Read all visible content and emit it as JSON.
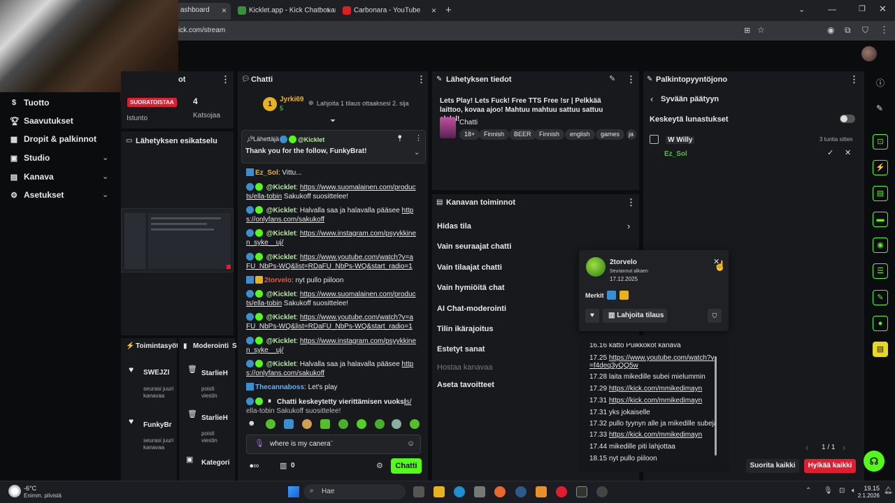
{
  "browser": {
    "tabs": [
      {
        "title": "ashboard"
      },
      {
        "title": "Kicklet.app - Kick Chatbot and"
      },
      {
        "title": "Carbonara - YouTube"
      }
    ],
    "url": "kick.com/stream",
    "new_tab": "+"
  },
  "sidebar": {
    "items": [
      {
        "label": "Tuotto",
        "icon": "money-icon"
      },
      {
        "label": "Saavutukset",
        "icon": "trophy-icon"
      },
      {
        "label": "Dropit & palkinnot",
        "icon": "gift-icon"
      },
      {
        "label": "Studio",
        "icon": "studio-icon"
      },
      {
        "label": "Kanava",
        "icon": "channel-icon"
      },
      {
        "label": "Asetukset",
        "icon": "gear-icon"
      }
    ]
  },
  "stats": {
    "title_fragment": "ot",
    "live_badge": "SUORATOISTAA",
    "session_label": "Istunto",
    "viewers": "4",
    "viewers_label": "Katsojaa"
  },
  "preview": {
    "title": "Lähetyksen esikatselu"
  },
  "activity": {
    "tab_title": "Toimintasyöt",
    "items": [
      {
        "name": "SWEJZI",
        "desc": "seurasi juuri kanavaa"
      },
      {
        "name": "FunkyBr",
        "desc": "seurasi juuri kanavaa"
      }
    ]
  },
  "moderation": {
    "tab_title": "Moderointi",
    "tab_extra": "S",
    "items": [
      {
        "name": "StarlieH",
        "desc": "poisti viestin"
      },
      {
        "name": "StarlieH",
        "desc": "poisti viestin"
      },
      {
        "name": "Kategori",
        "desc": ""
      }
    ]
  },
  "chat": {
    "title": "Chatti",
    "top_gifter": {
      "name": "Jyrki69",
      "count": "5",
      "rank": "1"
    },
    "gift_prompt": "Lahjoita 1 tilaus ottaaksesi 2. sija",
    "pinned": {
      "label": "Lähettäjä",
      "sender": "@Kicklet",
      "message": "Thank you for the follow, FunkyBrat!"
    },
    "messages": [
      {
        "user": "Ez_Sol",
        "color": "#e8b21f",
        "text": ": Vittu..."
      },
      {
        "user": "@Kicklet",
        "color": "#b4e8a0",
        "text": ": ",
        "link": "https://www.suomalainen.com/products/ella-tobin",
        "after": " Sakukoff suosittelee!"
      },
      {
        "user": "@Kicklet",
        "color": "#b4e8a0",
        "text": ": Halvalla saa ja halavalla pääsee ",
        "link": "https://onlyfans.com/sakukoff",
        "after": ""
      },
      {
        "user": "@Kicklet",
        "color": "#b4e8a0",
        "text": ": ",
        "link": "https://www.instagram.com/psyykkinen_syke__uj/",
        "after": ""
      },
      {
        "user": "@Kicklet",
        "color": "#b4e8a0",
        "text": ": ",
        "link": "https://www.youtube.com/watch?v=aFU_NbPs-WQ&list=RDaFU_NbPs-WQ&start_radio=1",
        "after": ""
      },
      {
        "user": "2torvelo",
        "color": "#e8593a",
        "text": ": nyt pullo piiloon"
      },
      {
        "user": "@Kicklet",
        "color": "#b4e8a0",
        "text": ": ",
        "link": "https://www.suomalainen.com/products/ella-tobin",
        "after": " Sakukoff suosittelee!"
      },
      {
        "user": "@Kicklet",
        "color": "#b4e8a0",
        "text": ": ",
        "link": "https://www.youtube.com/watch?v=aFU_NbPs-WQ&list=RDaFU_NbPs-WQ&start_radio=1",
        "after": ""
      },
      {
        "user": "@Kicklet",
        "color": "#b4e8a0",
        "text": ": ",
        "link": "https://www.instagram.com/psyykkinen_syke__uj/",
        "after": ""
      },
      {
        "user": "@Kicklet",
        "color": "#b4e8a0",
        "text": ": Halvalla saa ja halavalla pääsee ",
        "link": "https://onlyfans.com/sakukoff",
        "after": ""
      },
      {
        "user": "Thecannaboss",
        "color": "#6ab0e8",
        "text": ": Let's play"
      }
    ],
    "paused_notice": "Chatti keskeytetty vierittämisen vuoksi",
    "paused_tail": "ts/",
    "paused_under": "ella-tobin Sakukoff suosittelee!",
    "input_value": "where is my canera¨",
    "kicks_count": "0",
    "send_label": "Chatti"
  },
  "stream_info": {
    "title": "Lähetyksen tiedot",
    "stream_title": "Lets Play! Lets Fuck! Free TTS Free !sr | Pelkkää laittoo, kovaa ajoo! Mahtuu mahtuu sattuu sattuu alalal!",
    "category": "Chatti",
    "tags": [
      "18+",
      "Finnish",
      "BEER",
      "Finnish",
      "english",
      "games",
      "ja"
    ]
  },
  "channel_actions": {
    "title": "Kanavan toiminnot",
    "items": [
      "Hidas tila",
      "Vain seuraajat chatti",
      "Vain tilaajat chatti",
      "Vain hymiöitä chat",
      "AI Chat-moderointi",
      "Tilin ikärajoitus",
      "Estetyt sanat",
      "Hostaa kanavaa",
      "Aseta tavoitteet"
    ]
  },
  "user_card": {
    "name": "2torvelo",
    "follow_label": "Seurannut alkaen",
    "follow_date": "17.12.2025",
    "badges_label": "Merkit",
    "gift_button": "Lahjoita tilaus"
  },
  "reward_queue": {
    "title": "Palkintopyyntöjono",
    "back_label": "Syvään päätyyn",
    "pause_label": "Keskeytä lunastukset",
    "entry": {
      "user": "W Willy",
      "time": "3 tuntia sitten",
      "requester": "Ez_Sol"
    },
    "pager": "1 / 1",
    "complete_all": "Suorita kaikki",
    "reject_all": "Hylkää kaikki"
  },
  "queue_log": [
    {
      "time": "16.16",
      "text": "katto Puikkokot kanava",
      "link": false
    },
    {
      "time": "17.25",
      "text": "https://www.youtube.com/watch?v=f4deq3yQQ5w",
      "link": true
    },
    {
      "time": "17.28",
      "text": "laita mikedille subei mielummin",
      "link": false
    },
    {
      "time": "17.29",
      "text": "https://kick.com/mmikedimayn",
      "link": true
    },
    {
      "time": "17.31",
      "text": "https://kick.com/mmikedimayn",
      "link": true
    },
    {
      "time": "17.31",
      "text": "yks jokaiselle",
      "link": false
    },
    {
      "time": "17.32",
      "text": "pullo tyynyn alle ja mikedille subeja",
      "link": false
    },
    {
      "time": "17.33",
      "text": "https://kick.com/mmikedimayn",
      "link": true
    },
    {
      "time": "17.44",
      "text": "mikedille piti lahjottaa",
      "link": false
    },
    {
      "time": "18.15",
      "text": "nyt pullo piiloon",
      "link": false
    }
  ],
  "taskbar": {
    "weather_temp": "-6°C",
    "weather_desc": "Enimm. pilvistä",
    "search": "Hae",
    "time": "19.15",
    "date": "2.1.2026"
  },
  "colors": {
    "accent": "#53fc18",
    "danger": "#e11d2f",
    "panel": "#18191c"
  }
}
